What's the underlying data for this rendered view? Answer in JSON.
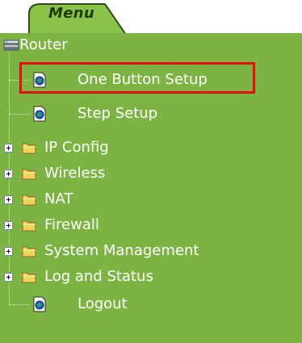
{
  "menu": {
    "tab_label": "Menu"
  },
  "tree": {
    "root": {
      "label": "Router",
      "icon": "router-icon"
    },
    "items": [
      {
        "label": "One Button Setup",
        "icon": "document-icon",
        "type": "page",
        "highlighted": true
      },
      {
        "label": "Step Setup",
        "icon": "document-icon",
        "type": "page"
      },
      {
        "label": "IP Config",
        "icon": "folder-icon",
        "type": "folder",
        "expander": "plus"
      },
      {
        "label": "Wireless",
        "icon": "folder-icon",
        "type": "folder",
        "expander": "plus"
      },
      {
        "label": "NAT",
        "icon": "folder-icon",
        "type": "folder",
        "expander": "plus"
      },
      {
        "label": "Firewall",
        "icon": "folder-icon",
        "type": "folder",
        "expander": "plus"
      },
      {
        "label": "System Management",
        "icon": "folder-icon",
        "type": "folder",
        "expander": "plus"
      },
      {
        "label": "Log and Status",
        "icon": "folder-icon",
        "type": "folder",
        "expander": "plus"
      },
      {
        "label": "Logout",
        "icon": "document-icon",
        "type": "page"
      }
    ]
  },
  "colors": {
    "panel_background": "#7cb342",
    "tab_background": "#8bc34a",
    "text": "#ffffff",
    "highlight_border": "#e01010"
  }
}
